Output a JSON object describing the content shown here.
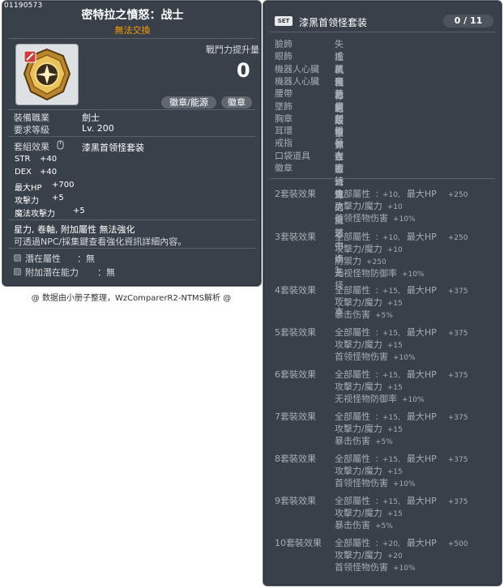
{
  "item": {
    "id": "01190573",
    "title": "密特拉之憤怒：战士",
    "trade": "無法交換",
    "power_label": "戰鬥力提升量",
    "power_value": "0",
    "btn_emblem_power": "徽章/能源",
    "btn_emblem": "徽章",
    "job_label": "裝備職業",
    "job_value": "劍士",
    "level_label": "要求等級",
    "level_value": "Lv. 200",
    "set_effect_label": "套組效果",
    "set_effect_value": "漆黑首领怪套装",
    "stats": [
      {
        "name": "STR",
        "value": "+40"
      },
      {
        "name": "DEX",
        "value": "+40"
      },
      {
        "name": "最大HP",
        "value": "+700"
      },
      {
        "name": "攻擊力",
        "value": "+5"
      },
      {
        "name": "魔法攻擊力",
        "value": "+5"
      }
    ],
    "tags": "星力, 卷軸, 附加屬性 無法強化",
    "note": "可透過NPC/採集鍵查看強化資訊詳細內容。",
    "potential_label": "潛在屬性",
    "potential_value": "：無",
    "bonus_potential_label": "附加潛在能力",
    "bonus_potential_value": "：無"
  },
  "credit": "@ 数据由小册子整理，WzComparerR2-NTMS解析 @",
  "set": {
    "badge": "SET",
    "name": "漆黑首领怪套装",
    "count": "0 / 11",
    "items": [
      {
        "slot": "臉飾",
        "name": "失控机械标记"
      },
      {
        "slot": "眼飾",
        "name": "遙藏魔力的眼罩"
      },
      {
        "slot": "機器人心臟",
        "name": "黑色心脏"
      },
      {
        "slot": "機器人心臟",
        "name": "完全掌控"
      },
      {
        "slot": "腰帶",
        "name": "梦幻腰带"
      },
      {
        "slot": "墜飾",
        "name": "痛苦根源"
      },
      {
        "slot": "胸章",
        "name": "创世徽章"
      },
      {
        "slot": "耳環",
        "name": "船长姿态耳环"
      },
      {
        "slot": "戒指",
        "name": "巨大的恐惧"
      },
      {
        "slot": "口袋道具",
        "name": "在被诅咒的魔道书中选择一本"
      },
      {
        "slot": "徽章",
        "name": "密特拉之愤怒中选1"
      }
    ],
    "bonuses": [
      {
        "label": "2套裝效果",
        "lines": [
          [
            "全部屬性",
            "：+10,",
            "最大HP",
            "+250"
          ],
          [
            "攻擊力/魔力",
            "+10",
            "",
            ""
          ],
          [
            "首领怪物伤害",
            "+10%",
            "",
            ""
          ]
        ]
      },
      {
        "label": "3套裝效果",
        "lines": [
          [
            "全部屬性",
            "：+10,",
            "最大HP",
            "+250"
          ],
          [
            "攻擊力/魔力",
            "+10",
            "",
            ""
          ],
          [
            "防禦力",
            "+250",
            "",
            ""
          ],
          [
            "无视怪物防御率",
            "+10%",
            "",
            ""
          ]
        ]
      },
      {
        "label": "4套裝效果",
        "lines": [
          [
            "全部屬性",
            "：+15,",
            "最大HP",
            "+375"
          ],
          [
            "攻擊力/魔力",
            "+15",
            "",
            ""
          ],
          [
            "暴击伤害",
            "+5%",
            "",
            ""
          ]
        ]
      },
      {
        "label": "5套裝效果",
        "lines": [
          [
            "全部屬性",
            "：+15,",
            "最大HP",
            "+375"
          ],
          [
            "攻擊力/魔力",
            "+15",
            "",
            ""
          ],
          [
            "首领怪物伤害",
            "+10%",
            "",
            ""
          ]
        ]
      },
      {
        "label": "6套裝效果",
        "lines": [
          [
            "全部屬性",
            "：+15,",
            "最大HP",
            "+375"
          ],
          [
            "攻擊力/魔力",
            "+15",
            "",
            ""
          ],
          [
            "无视怪物防御率",
            "+10%",
            "",
            ""
          ]
        ]
      },
      {
        "label": "7套裝效果",
        "lines": [
          [
            "全部屬性",
            "：+15,",
            "最大HP",
            "+375"
          ],
          [
            "攻擊力/魔力",
            "+15",
            "",
            ""
          ],
          [
            "暴击伤害",
            "+5%",
            "",
            ""
          ]
        ]
      },
      {
        "label": "8套裝效果",
        "lines": [
          [
            "全部屬性",
            "：+15,",
            "最大HP",
            "+375"
          ],
          [
            "攻擊力/魔力",
            "+15",
            "",
            ""
          ],
          [
            "首领怪物伤害",
            "+10%",
            "",
            ""
          ]
        ]
      },
      {
        "label": "9套裝效果",
        "lines": [
          [
            "全部屬性",
            "：+15,",
            "最大HP",
            "+375"
          ],
          [
            "攻擊力/魔力",
            "+15",
            "",
            ""
          ],
          [
            "暴击伤害",
            "+5%",
            "",
            ""
          ]
        ]
      },
      {
        "label": "10套裝效果",
        "lines": [
          [
            "全部屬性",
            "：+20,",
            "最大HP",
            "+500"
          ],
          [
            "攻擊力/魔力",
            "+20",
            "",
            ""
          ],
          [
            "首领怪物伤害",
            "+10%",
            "",
            ""
          ]
        ]
      }
    ]
  }
}
